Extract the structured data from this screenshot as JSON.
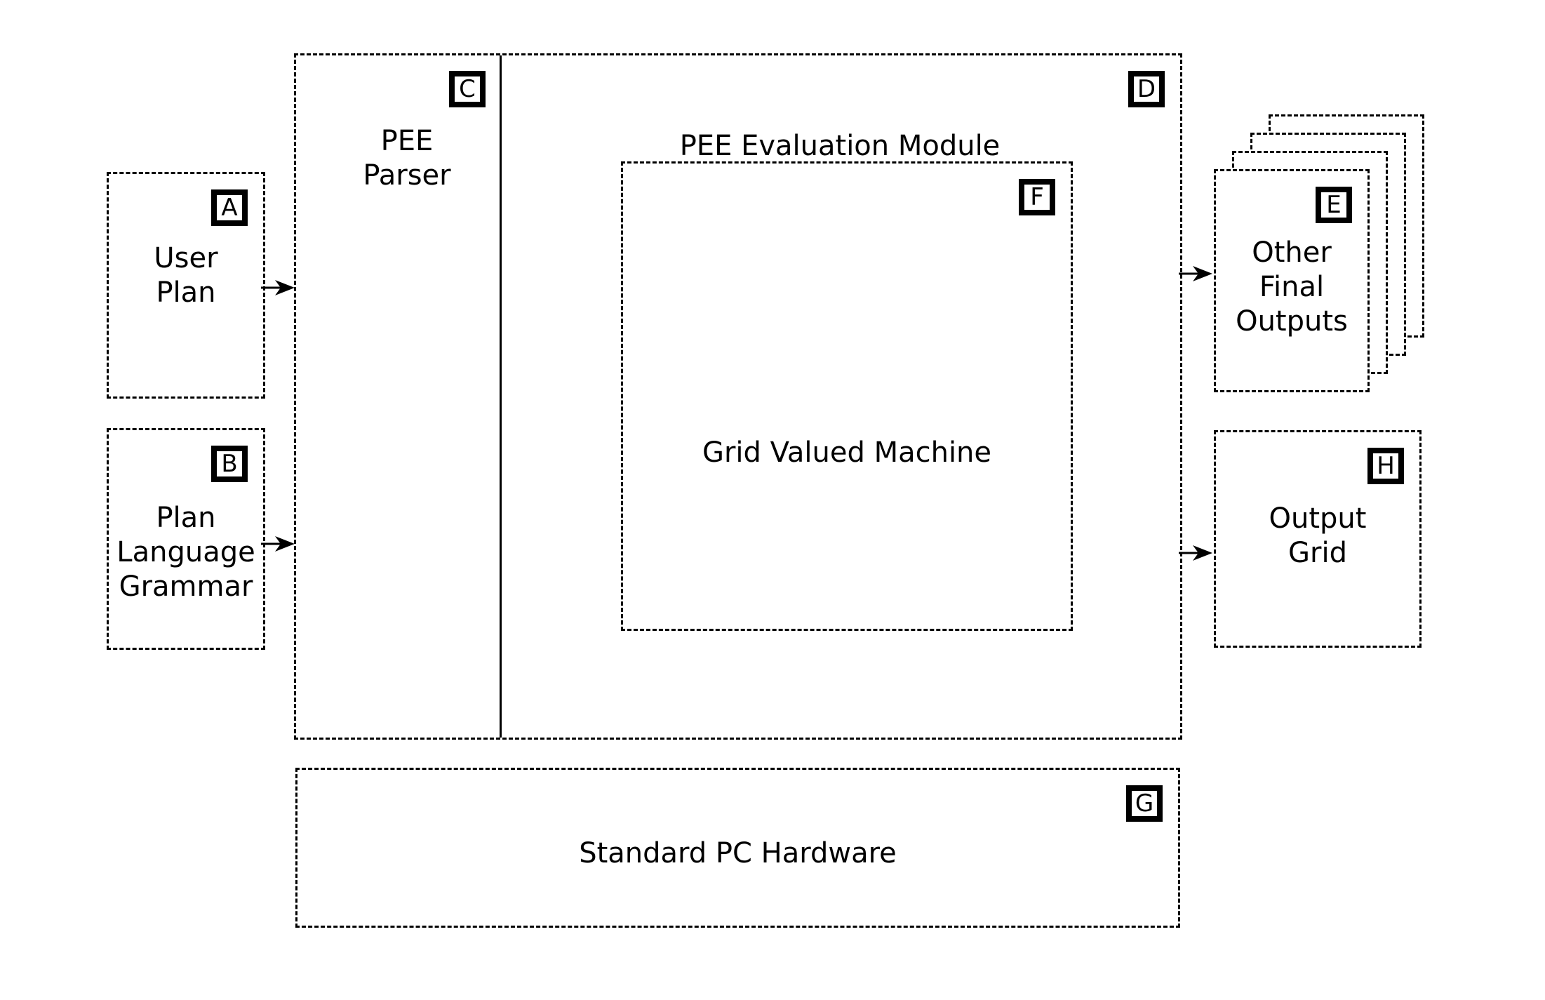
{
  "diagram": {
    "title": "PEE system architecture block diagram",
    "colors": {
      "stroke": "#000000",
      "fill": "#ffffff",
      "text": "#000000"
    },
    "blocks": {
      "user_plan": {
        "tag": "A",
        "label": "User\nPlan"
      },
      "plan_grammar": {
        "tag": "B",
        "label": "Plan\nLanguage\nGrammar"
      },
      "pee_parser": {
        "tag": "C",
        "label": "PEE\nParser"
      },
      "pee_module": {
        "tag": "D",
        "label": "PEE Evaluation Module"
      },
      "other_outputs": {
        "tag": "E",
        "label": "Other\nFinal\nOutputs",
        "sheet_count": 4
      },
      "grid_machine": {
        "tag": "F",
        "label": "Grid Valued Machine"
      },
      "hardware": {
        "tag": "G",
        "label": "Standard PC Hardware"
      },
      "output_grid": {
        "tag": "H",
        "label": "Output\nGrid"
      }
    },
    "arrows": [
      {
        "name": "user-plan-to-parser",
        "from": "A",
        "to": "C"
      },
      {
        "name": "grammar-to-parser",
        "from": "B",
        "to": "C"
      },
      {
        "name": "module-to-other-outputs",
        "from": "D",
        "to": "E"
      },
      {
        "name": "module-to-output-grid",
        "from": "D",
        "to": "H"
      }
    ]
  }
}
